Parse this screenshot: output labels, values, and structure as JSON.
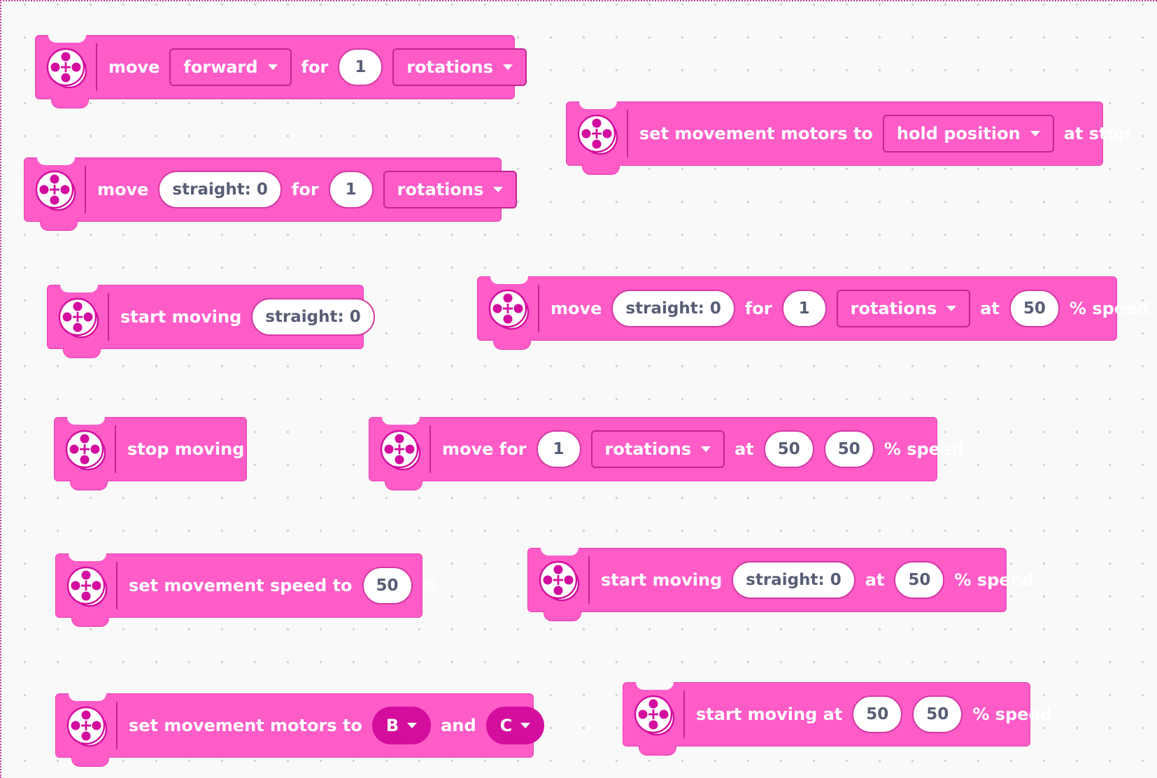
{
  "colors": {
    "block_fill": "#ff5cc8",
    "block_border": "#e842b0",
    "divider": "#c2268f",
    "icon_magenta": "#d30d9e",
    "field_text": "#575e75",
    "canvas_bg": "#f9f9f9"
  },
  "icon": "movement-motors-icon",
  "blocks": {
    "b1": {
      "move": "move",
      "direction": "forward",
      "for": "for",
      "amount": "1",
      "unit": "rotations"
    },
    "b2": {
      "set_movement_motors_to": "set movement motors to",
      "stop_mode": "hold position",
      "at_stop": "at stop"
    },
    "b3": {
      "move": "move",
      "steer": "straight: 0",
      "for": "for",
      "amount": "1",
      "unit": "rotations"
    },
    "b4": {
      "start_moving": "start moving",
      "steer": "straight: 0"
    },
    "b5": {
      "move": "move",
      "steer": "straight: 0",
      "for": "for",
      "amount": "1",
      "unit": "rotations",
      "at": "at",
      "speed": "50",
      "pct_speed": "% speed"
    },
    "b6": {
      "stop_moving": "stop moving"
    },
    "b7": {
      "move_for": "move for",
      "amount": "1",
      "unit": "rotations",
      "at": "at",
      "left_speed": "50",
      "right_speed": "50",
      "pct_speed": "% speed"
    },
    "b8": {
      "set_movement_speed_to": "set movement speed to",
      "speed": "50",
      "pct": "%"
    },
    "b9": {
      "start_moving": "start moving",
      "steer": "straight: 0",
      "at": "at",
      "speed": "50",
      "pct_speed": "% speed"
    },
    "b10": {
      "set_movement_motors_to": "set movement motors to",
      "port_a": "B",
      "and": "and",
      "port_b": "C"
    },
    "b11": {
      "start_moving_at": "start moving at",
      "left_speed": "50",
      "right_speed": "50",
      "pct_speed": "% speed"
    }
  }
}
